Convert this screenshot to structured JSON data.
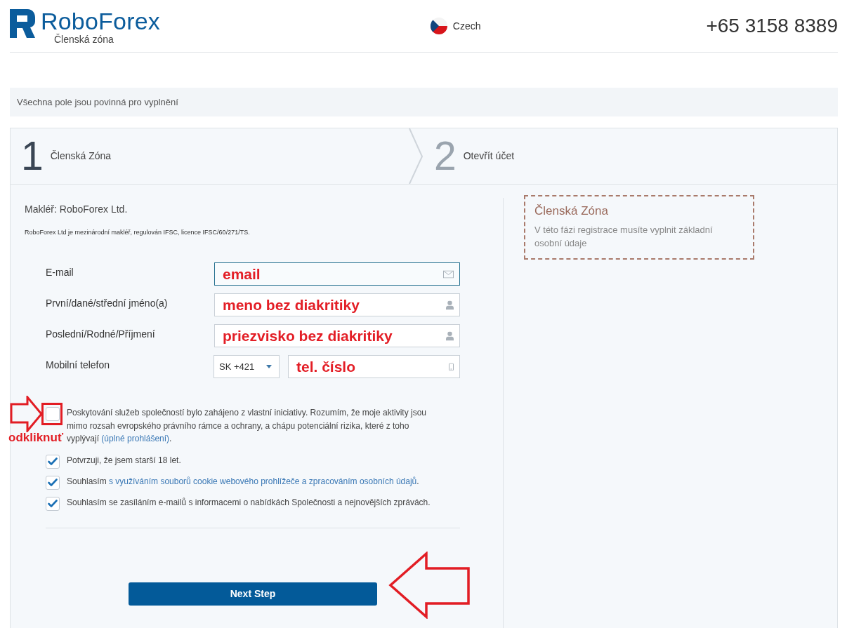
{
  "header": {
    "brand": "RoboForex",
    "subtitle": "Členská zóna",
    "language": "Czech",
    "phone": "+65 3158 8389"
  },
  "notice": "Všechna pole jsou povinná pro vyplnění",
  "steps": [
    {
      "number": "1",
      "label": "Členská Zóna",
      "selected": true
    },
    {
      "number": "2",
      "label": "Otevřít účet",
      "selected": false
    }
  ],
  "broker": {
    "title": "Makléř: RoboForex Ltd.",
    "note": "RoboForex Ltd je mezinárodní makléř, regulován IFSC, licence IFSC/60/271/TS."
  },
  "fields": [
    {
      "label": "E-mail",
      "kind": "email",
      "value": "email",
      "focused": true
    },
    {
      "label": "První/dané/střední jméno(a)",
      "kind": "person",
      "value": "meno bez diakritiky",
      "focused": false
    },
    {
      "label": "Poslední/Rodné/Příjmení",
      "kind": "person",
      "value": "priezvisko bez diakritiky",
      "focused": false
    },
    {
      "label": "Mobilní telefon",
      "kind": "phone",
      "prefix": "SK +421",
      "value": "tel. číslo",
      "focused": false
    }
  ],
  "consents": [
    {
      "checked": false,
      "parts": [
        {
          "kind": "text",
          "text": "Poskytování služeb společností bylo zahájeno z vlastní iniciativy. Rozumím, že moje aktivity jsou mimo rozsah evropského právního rámce a ochrany, a chápu potenciální rizika, které z toho vyplývají "
        },
        {
          "kind": "link",
          "text": "(úplné prohlášení)"
        },
        {
          "kind": "text",
          "text": "."
        }
      ]
    },
    {
      "checked": true,
      "parts": [
        {
          "kind": "text",
          "text": "Potvrzuji, že jsem starší 18 let."
        }
      ]
    },
    {
      "checked": true,
      "parts": [
        {
          "kind": "text",
          "text": "Souhlasím "
        },
        {
          "kind": "link",
          "text": "s využíváním souborů cookie webového prohlížeče a zpracováním osobních údajů"
        },
        {
          "kind": "text",
          "text": "."
        }
      ]
    },
    {
      "checked": true,
      "parts": [
        {
          "kind": "text",
          "text": "Souhlasím se zasíláním e-mailů s informacemi o nabídkách Společnosti a nejnovějších zprávách."
        }
      ]
    }
  ],
  "next_button": "Next Step",
  "info_box": {
    "title": "Členská Zóna",
    "text": "V této fázi registrace musíte vyplnit základní osobní údaje"
  },
  "annotations": [
    {
      "kind": "arrow-right"
    },
    {
      "kind": "frame"
    },
    {
      "kind": "label",
      "text": "odkliknuť"
    },
    {
      "kind": "arrow-left"
    }
  ]
}
